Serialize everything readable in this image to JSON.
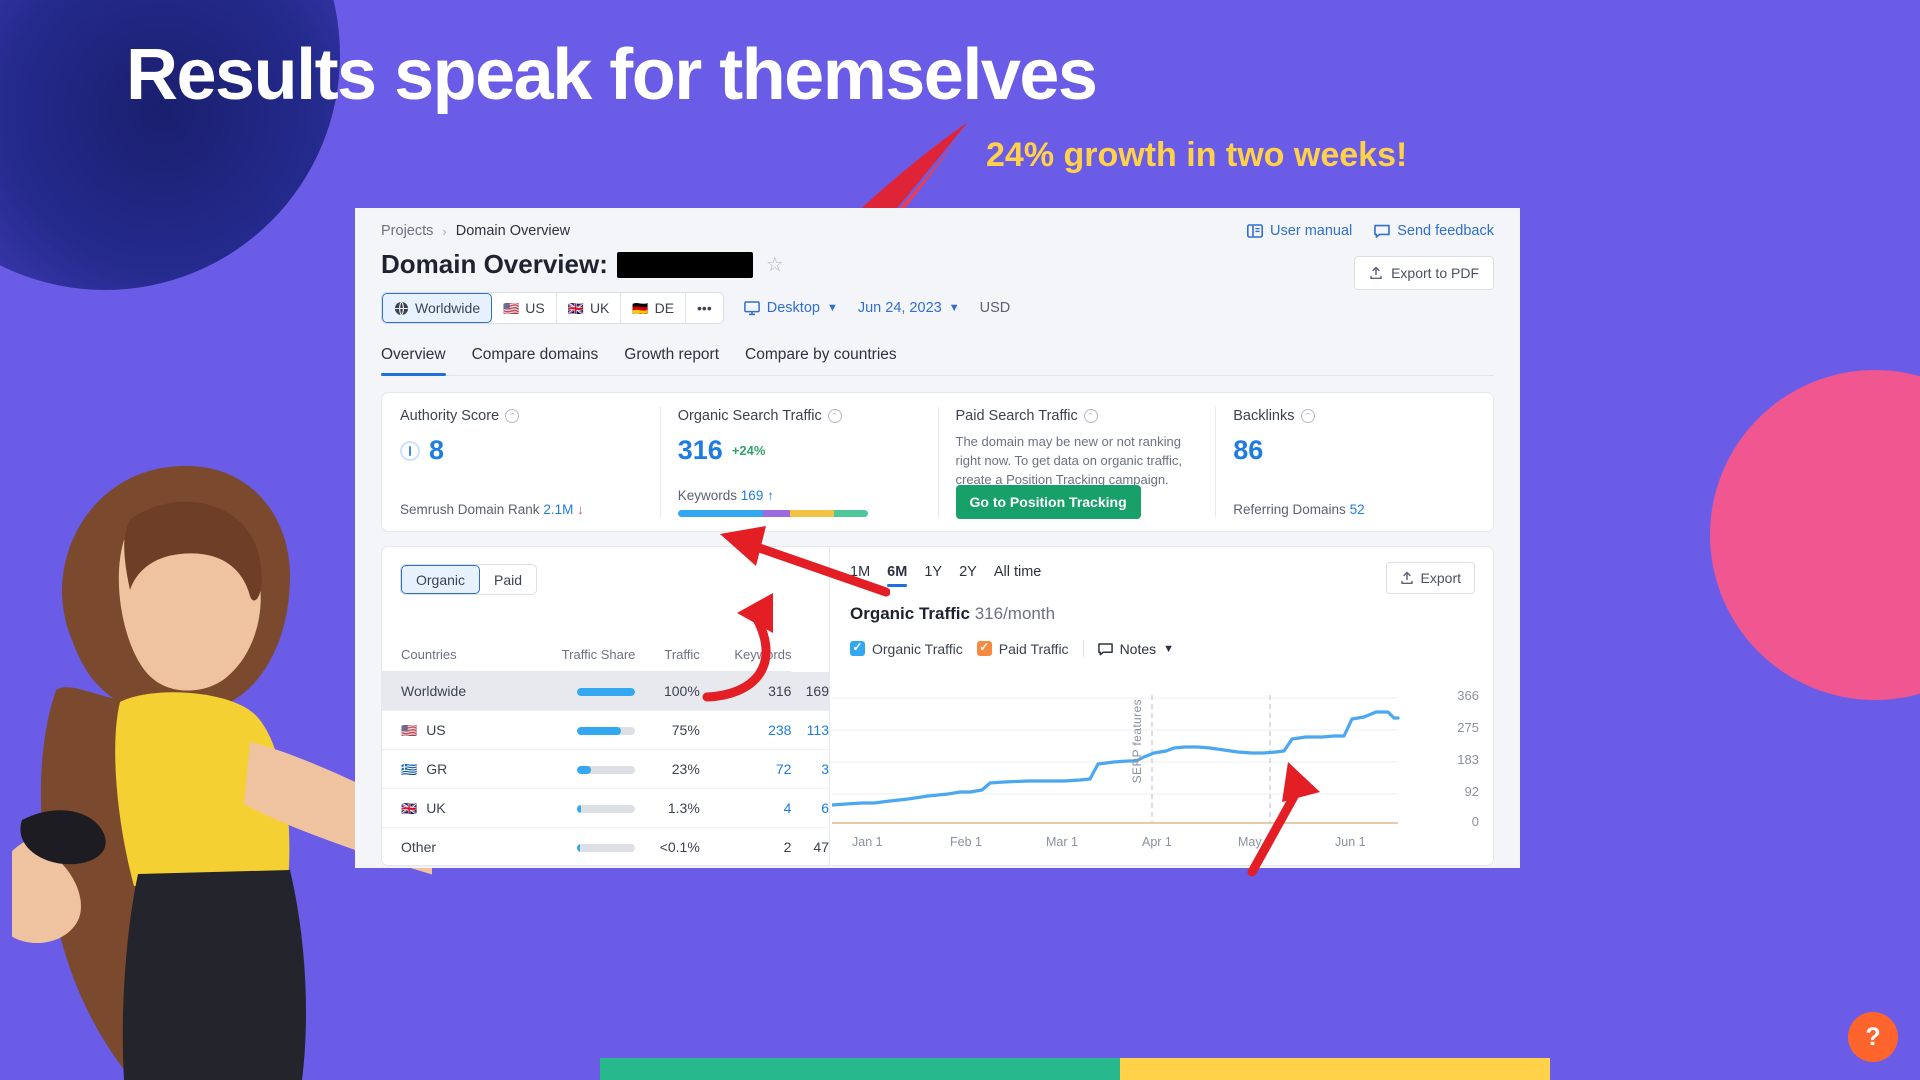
{
  "promo": {
    "headline": "Results speak for themselves",
    "growth_callout": "24% growth in two weeks!",
    "headline_color": "#FFFFFF",
    "callout_color": "#FFD24A",
    "background_color": "#6B5CE7"
  },
  "breadcrumb": {
    "parent": "Projects",
    "separator": "›",
    "current": "Domain Overview"
  },
  "header": {
    "title_label": "Domain Overview:",
    "domain_value": "",
    "star_icon": "star-icon",
    "user_manual": "User manual",
    "send_feedback": "Send feedback",
    "export_pdf": "Export to PDF"
  },
  "filters": {
    "countries": [
      {
        "label": "Worldwide",
        "flag": "globe",
        "active": true
      },
      {
        "label": "US",
        "flag": "🇺🇸",
        "active": false
      },
      {
        "label": "UK",
        "flag": "🇬🇧",
        "active": false
      },
      {
        "label": "DE",
        "flag": "🇩🇪",
        "active": false
      },
      {
        "label": "•••",
        "flag": "",
        "active": false
      }
    ],
    "device": "Desktop",
    "date": "Jun 24, 2023",
    "currency": "USD"
  },
  "tabs": [
    {
      "label": "Overview",
      "active": true
    },
    {
      "label": "Compare domains",
      "active": false
    },
    {
      "label": "Growth report",
      "active": false
    },
    {
      "label": "Compare by countries",
      "active": false
    }
  ],
  "cards": {
    "authority": {
      "title": "Authority Score",
      "value": "8",
      "foot_label": "Semrush Domain Rank",
      "foot_value": "2.1M",
      "foot_trend": "↓"
    },
    "organic": {
      "title": "Organic Search Traffic",
      "value": "316",
      "delta": "+24%",
      "keywords_label": "Keywords",
      "keywords_value": "169",
      "keywords_trend": "↑",
      "bar_segments": [
        {
          "color": "#33A7F0",
          "pct": 45
        },
        {
          "color": "#9B6BE0",
          "pct": 14
        },
        {
          "color": "#F5C243",
          "pct": 23
        },
        {
          "color": "#4FC79A",
          "pct": 18
        }
      ]
    },
    "paid": {
      "title": "Paid Search Traffic",
      "description": "The domain may be new or not ranking right now. To get data on organic traffic, create a Position Tracking campaign.",
      "button": "Go to Position Tracking"
    },
    "backlinks": {
      "title": "Backlinks",
      "value": "86",
      "foot_label": "Referring Domains",
      "foot_value": "52"
    }
  },
  "countries_panel": {
    "segments": [
      {
        "label": "Organic",
        "active": true
      },
      {
        "label": "Paid",
        "active": false
      }
    ],
    "columns": [
      "Countries",
      "Traffic Share",
      "Traffic",
      "Keywords"
    ],
    "rows": [
      {
        "country": "Worldwide",
        "flag": "",
        "share_pct": "100%",
        "share_fill": 100,
        "traffic": "316",
        "keywords": "169",
        "highlight": true
      },
      {
        "country": "US",
        "flag": "🇺🇸",
        "share_pct": "75%",
        "share_fill": 75,
        "traffic": "238",
        "keywords": "113",
        "highlight": false
      },
      {
        "country": "GR",
        "flag": "🇬🇷",
        "share_pct": "23%",
        "share_fill": 23,
        "traffic": "72",
        "keywords": "3",
        "highlight": false
      },
      {
        "country": "UK",
        "flag": "🇬🇧",
        "share_pct": "1.3%",
        "share_fill": 6,
        "traffic": "4",
        "keywords": "6",
        "highlight": false
      },
      {
        "country": "Other",
        "flag": "",
        "share_pct": "<0.1%",
        "share_fill": 4,
        "traffic": "2",
        "keywords": "47",
        "highlight": false
      }
    ]
  },
  "chart_panel": {
    "ranges": [
      {
        "label": "1M",
        "active": false
      },
      {
        "label": "6M",
        "active": true
      },
      {
        "label": "1Y",
        "active": false
      },
      {
        "label": "2Y",
        "active": false
      },
      {
        "label": "All time",
        "active": false
      }
    ],
    "export_label": "Export",
    "title": "Organic Traffic",
    "subtitle": "316/month",
    "legend": [
      {
        "label": "Organic Traffic",
        "color": "#33A7F0",
        "checked": true
      },
      {
        "label": "Paid Traffic",
        "color": "#F58A40",
        "checked": true
      }
    ],
    "notes_label": "Notes",
    "annotation": "SERP features"
  },
  "chart_data": {
    "type": "line",
    "title": "Organic Traffic",
    "subtitle": "316/month",
    "xlabel": "",
    "ylabel": "",
    "ylim": [
      0,
      366
    ],
    "yticks": [
      0,
      92,
      183,
      275,
      366
    ],
    "ytick_labels": [
      "0",
      "92",
      "183",
      "275",
      "366"
    ],
    "xticks": [
      "Jan 1",
      "Feb 1",
      "Mar 1",
      "Apr 1",
      "May 1",
      "Jun 1"
    ],
    "grid": true,
    "legend_position": "top-left",
    "annotations": [
      {
        "text": "SERP features",
        "x": "Mar 20",
        "orientation": "vertical"
      }
    ],
    "series": [
      {
        "name": "Organic Traffic",
        "color": "#33A7F0",
        "style": "step",
        "x": [
          "Jan 1",
          "Jan 8",
          "Jan 15",
          "Jan 22",
          "Feb 1",
          "Feb 8",
          "Feb 15",
          "Feb 22",
          "Mar 1",
          "Mar 8",
          "Mar 15",
          "Mar 22",
          "Apr 1",
          "Apr 8",
          "Apr 15",
          "Apr 22",
          "May 1",
          "May 8",
          "May 15",
          "May 22",
          "Jun 1",
          "Jun 8",
          "Jun 15",
          "Jun 24"
        ],
        "values": [
          60,
          62,
          66,
          70,
          72,
          92,
          94,
          95,
          96,
          98,
          160,
          168,
          196,
          210,
          232,
          236,
          228,
          226,
          230,
          262,
          268,
          330,
          360,
          340
        ]
      },
      {
        "name": "Paid Traffic",
        "color": "#F58A40",
        "style": "line",
        "x": [
          "Jan 1",
          "Feb 1",
          "Mar 1",
          "Apr 1",
          "May 1",
          "Jun 1",
          "Jun 24"
        ],
        "values": [
          0,
          0,
          0,
          0,
          0,
          0,
          0
        ]
      }
    ]
  },
  "help": {
    "label": "?"
  }
}
